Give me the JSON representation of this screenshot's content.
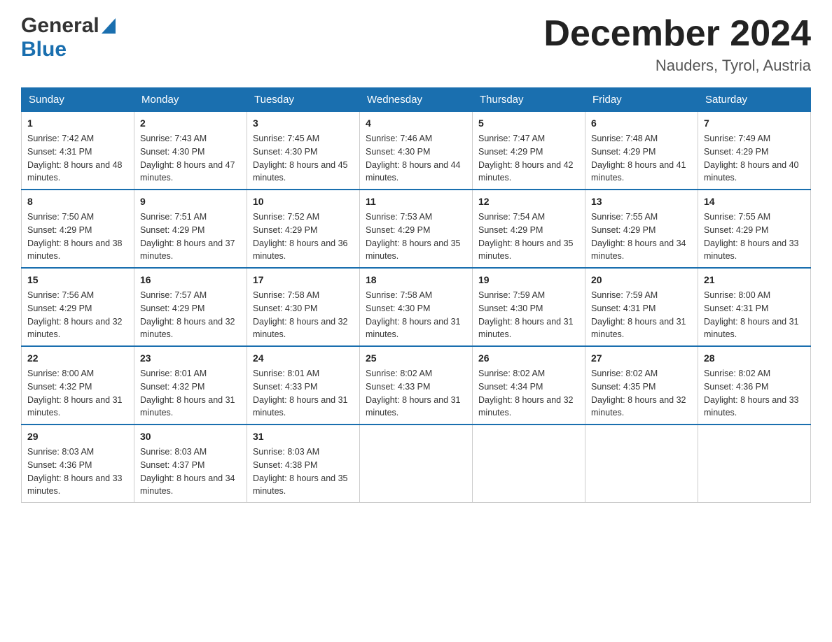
{
  "logo": {
    "general": "General",
    "blue": "Blue"
  },
  "title": "December 2024",
  "location": "Nauders, Tyrol, Austria",
  "days_header": [
    "Sunday",
    "Monday",
    "Tuesday",
    "Wednesday",
    "Thursday",
    "Friday",
    "Saturday"
  ],
  "weeks": [
    [
      {
        "num": "1",
        "sunrise": "7:42 AM",
        "sunset": "4:31 PM",
        "daylight": "8 hours and 48 minutes."
      },
      {
        "num": "2",
        "sunrise": "7:43 AM",
        "sunset": "4:30 PM",
        "daylight": "8 hours and 47 minutes."
      },
      {
        "num": "3",
        "sunrise": "7:45 AM",
        "sunset": "4:30 PM",
        "daylight": "8 hours and 45 minutes."
      },
      {
        "num": "4",
        "sunrise": "7:46 AM",
        "sunset": "4:30 PM",
        "daylight": "8 hours and 44 minutes."
      },
      {
        "num": "5",
        "sunrise": "7:47 AM",
        "sunset": "4:29 PM",
        "daylight": "8 hours and 42 minutes."
      },
      {
        "num": "6",
        "sunrise": "7:48 AM",
        "sunset": "4:29 PM",
        "daylight": "8 hours and 41 minutes."
      },
      {
        "num": "7",
        "sunrise": "7:49 AM",
        "sunset": "4:29 PM",
        "daylight": "8 hours and 40 minutes."
      }
    ],
    [
      {
        "num": "8",
        "sunrise": "7:50 AM",
        "sunset": "4:29 PM",
        "daylight": "8 hours and 38 minutes."
      },
      {
        "num": "9",
        "sunrise": "7:51 AM",
        "sunset": "4:29 PM",
        "daylight": "8 hours and 37 minutes."
      },
      {
        "num": "10",
        "sunrise": "7:52 AM",
        "sunset": "4:29 PM",
        "daylight": "8 hours and 36 minutes."
      },
      {
        "num": "11",
        "sunrise": "7:53 AM",
        "sunset": "4:29 PM",
        "daylight": "8 hours and 35 minutes."
      },
      {
        "num": "12",
        "sunrise": "7:54 AM",
        "sunset": "4:29 PM",
        "daylight": "8 hours and 35 minutes."
      },
      {
        "num": "13",
        "sunrise": "7:55 AM",
        "sunset": "4:29 PM",
        "daylight": "8 hours and 34 minutes."
      },
      {
        "num": "14",
        "sunrise": "7:55 AM",
        "sunset": "4:29 PM",
        "daylight": "8 hours and 33 minutes."
      }
    ],
    [
      {
        "num": "15",
        "sunrise": "7:56 AM",
        "sunset": "4:29 PM",
        "daylight": "8 hours and 32 minutes."
      },
      {
        "num": "16",
        "sunrise": "7:57 AM",
        "sunset": "4:29 PM",
        "daylight": "8 hours and 32 minutes."
      },
      {
        "num": "17",
        "sunrise": "7:58 AM",
        "sunset": "4:30 PM",
        "daylight": "8 hours and 32 minutes."
      },
      {
        "num": "18",
        "sunrise": "7:58 AM",
        "sunset": "4:30 PM",
        "daylight": "8 hours and 31 minutes."
      },
      {
        "num": "19",
        "sunrise": "7:59 AM",
        "sunset": "4:30 PM",
        "daylight": "8 hours and 31 minutes."
      },
      {
        "num": "20",
        "sunrise": "7:59 AM",
        "sunset": "4:31 PM",
        "daylight": "8 hours and 31 minutes."
      },
      {
        "num": "21",
        "sunrise": "8:00 AM",
        "sunset": "4:31 PM",
        "daylight": "8 hours and 31 minutes."
      }
    ],
    [
      {
        "num": "22",
        "sunrise": "8:00 AM",
        "sunset": "4:32 PM",
        "daylight": "8 hours and 31 minutes."
      },
      {
        "num": "23",
        "sunrise": "8:01 AM",
        "sunset": "4:32 PM",
        "daylight": "8 hours and 31 minutes."
      },
      {
        "num": "24",
        "sunrise": "8:01 AM",
        "sunset": "4:33 PM",
        "daylight": "8 hours and 31 minutes."
      },
      {
        "num": "25",
        "sunrise": "8:02 AM",
        "sunset": "4:33 PM",
        "daylight": "8 hours and 31 minutes."
      },
      {
        "num": "26",
        "sunrise": "8:02 AM",
        "sunset": "4:34 PM",
        "daylight": "8 hours and 32 minutes."
      },
      {
        "num": "27",
        "sunrise": "8:02 AM",
        "sunset": "4:35 PM",
        "daylight": "8 hours and 32 minutes."
      },
      {
        "num": "28",
        "sunrise": "8:02 AM",
        "sunset": "4:36 PM",
        "daylight": "8 hours and 33 minutes."
      }
    ],
    [
      {
        "num": "29",
        "sunrise": "8:03 AM",
        "sunset": "4:36 PM",
        "daylight": "8 hours and 33 minutes."
      },
      {
        "num": "30",
        "sunrise": "8:03 AM",
        "sunset": "4:37 PM",
        "daylight": "8 hours and 34 minutes."
      },
      {
        "num": "31",
        "sunrise": "8:03 AM",
        "sunset": "4:38 PM",
        "daylight": "8 hours and 35 minutes."
      },
      null,
      null,
      null,
      null
    ]
  ],
  "labels": {
    "sunrise_prefix": "Sunrise: ",
    "sunset_prefix": "Sunset: ",
    "daylight_prefix": "Daylight: "
  }
}
